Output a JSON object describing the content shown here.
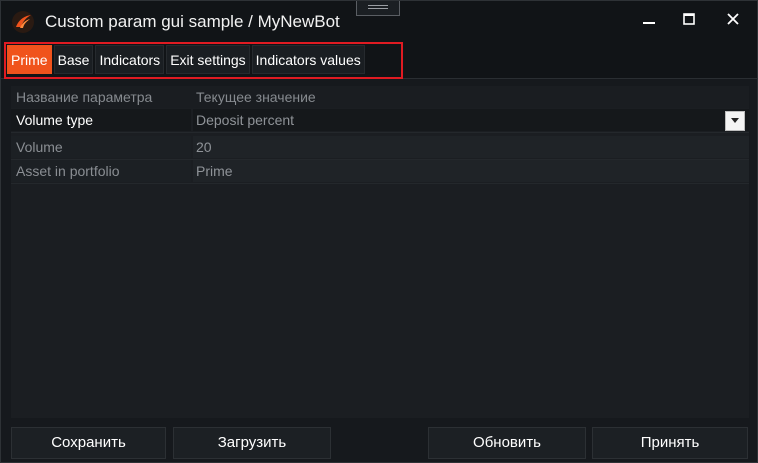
{
  "window": {
    "title": "Custom param gui sample / MyNewBot",
    "controls": [
      "minimize-icon",
      "maximize-icon",
      "close-icon"
    ]
  },
  "colors": {
    "accent": "#f0531c",
    "highlight_border": "#e01b22",
    "background": "#16191d"
  },
  "tabs": [
    {
      "label": "Prime",
      "active": true
    },
    {
      "label": "Base",
      "active": false
    },
    {
      "label": "Indicators",
      "active": false
    },
    {
      "label": "Exit settings",
      "active": false
    },
    {
      "label": "Indicators values",
      "active": false
    }
  ],
  "grid": {
    "headers": {
      "name": "Название параметра",
      "value": "Текущее значение"
    },
    "rows": [
      {
        "name": "Volume type",
        "value": "Deposit percent",
        "control": "dropdown"
      },
      {
        "name": "Volume",
        "value": "20"
      },
      {
        "name": "Asset in portfolio",
        "value": "Prime"
      }
    ]
  },
  "buttons": {
    "save": "Сохранить",
    "load": "Загрузить",
    "update": "Обновить",
    "accept": "Принять"
  }
}
